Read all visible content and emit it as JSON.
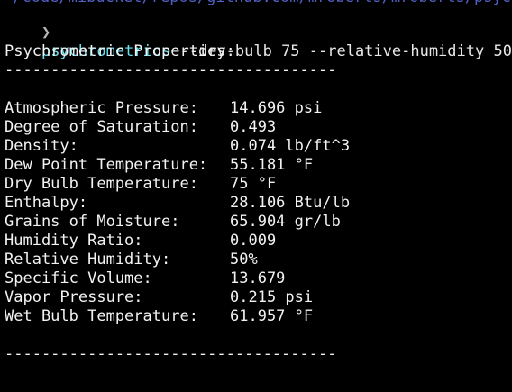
{
  "terminal": {
    "previous_line": "~/code/mibucket/repos/github.com/mroberts/mroberts/psych",
    "prompt_symbol": "❯",
    "command": {
      "executable": "psychrometrics",
      "args": " --dry-bulb 75 --relative-humidity 50"
    },
    "heading": "Psychrometric Properties:",
    "separator": "------------------------------------",
    "rows": [
      {
        "label": "Atmospheric Pressure:",
        "value": "14.696 psi"
      },
      {
        "label": "Degree of Saturation:",
        "value": "0.493"
      },
      {
        "label": "Density:",
        "value": "0.074 lb/ft^3"
      },
      {
        "label": "Dew Point Temperature:",
        "value": "55.181 °F"
      },
      {
        "label": "Dry Bulb Temperature:",
        "value": "75 °F"
      },
      {
        "label": "Enthalpy:",
        "value": "28.106 Btu/lb"
      },
      {
        "label": "Grains of Moisture:",
        "value": "65.904 gr/lb"
      },
      {
        "label": "Humidity Ratio:",
        "value": "0.009"
      },
      {
        "label": "Relative Humidity:",
        "value": "50%"
      },
      {
        "label": "Specific Volume:",
        "value": "13.679"
      },
      {
        "label": "Vapor Pressure:",
        "value": "0.215 psi"
      },
      {
        "label": "Wet Bulb Temperature:",
        "value": "61.957 °F"
      }
    ],
    "footer_separator": "------------------------------------"
  },
  "colors": {
    "background": "#000000",
    "text": "#f2f2f2",
    "command_accent": "#67e0f0",
    "path_accent": "#5a6bd8"
  }
}
